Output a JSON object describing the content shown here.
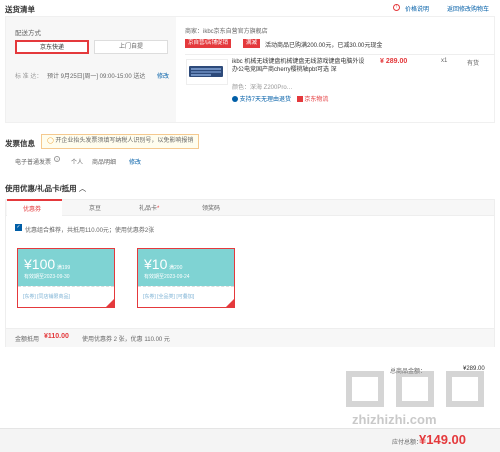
{
  "header": {
    "title": "送货清单",
    "price_note": "价格说明",
    "back_cart": "返回修改购物车"
  },
  "delivery": {
    "title": "配送方式",
    "options": [
      "京东快递",
      "上门自提"
    ],
    "schedule_label": "标 准 达：",
    "schedule_text": "预计 9月25日[周一] 09:00-15:00 送达",
    "schedule_edit": "修改"
  },
  "shop": {
    "label": "商家：",
    "name": "ikbc京东自营官方旗舰店",
    "tag_self": "京自营/店铺促销",
    "tag_promo": "满减",
    "promo_text": "活动商品已购满200.00元，已减30.00元现金",
    "product_title": "ikbc 机械无线键盘机械键盘无线游戏键盘电脑外设办公电竞国产商cherry樱桃轴pbt可选 深",
    "product_color": "颜色：深海 Z200Pro…",
    "price": "¥ 289.00",
    "qty": "x1",
    "stock": "有货",
    "return_note": "支持7天无理由退货",
    "logistics": "京东物流"
  },
  "invoice": {
    "title": "发票信息",
    "tip": "开企业抬头发票须填写纳税人识别号，以免影响报销",
    "type": "电子普通发票",
    "person": "个人",
    "detail": "商品明细",
    "edit": "修改"
  },
  "coupons": {
    "title": "使用优惠/礼品卡/抵用",
    "tabs": [
      "优惠券",
      "京豆",
      "礼品卡",
      "领奖码"
    ],
    "combo_text": "优惠组合推荐，共抵用110.00元；使用优惠券2张",
    "items": [
      {
        "amount": "¥100",
        "cond": "满199",
        "valid": "有效期至2023-09-30",
        "tags": "[东券] [同店铺限商品]"
      },
      {
        "amount": "¥10",
        "cond": "满200",
        "valid": "有效期至2023-09-24",
        "tags": "[东券] [全品类] [可叠加]"
      }
    ],
    "summary_label": "金额抵用",
    "summary_amount": "¥110.00",
    "summary_detail": "使用优惠券 2 张，优惠 110.00 元"
  },
  "totals": {
    "total_label": "总商品金额：",
    "total_value": "¥289.00",
    "payable_label": "应付总额：",
    "payable_value": "¥149.00"
  },
  "watermark": "zhizhizhi.com",
  "colors": {
    "red": "#e4393c",
    "link": "#005ea7",
    "coupon": "#7fd3d3"
  }
}
